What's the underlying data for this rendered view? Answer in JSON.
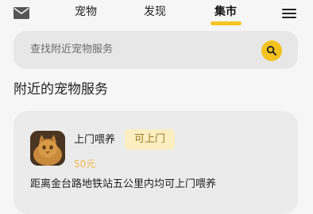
{
  "nav": {
    "tabs": [
      {
        "label": "宠物",
        "active": false
      },
      {
        "label": "发现",
        "active": false
      },
      {
        "label": "集市",
        "active": true
      }
    ]
  },
  "search": {
    "placeholder": "查找附近宠物服务"
  },
  "section": {
    "title": "附近的宠物服务"
  },
  "services": [
    {
      "name": "上门喂养",
      "tag": "可上门",
      "price": "50元",
      "description": "距离金台路地铁站五公里内均可上门喂养"
    }
  ],
  "colors": {
    "accent": "#f4c21e",
    "tag_bg": "#fbeec0",
    "price": "#f0b84a"
  }
}
